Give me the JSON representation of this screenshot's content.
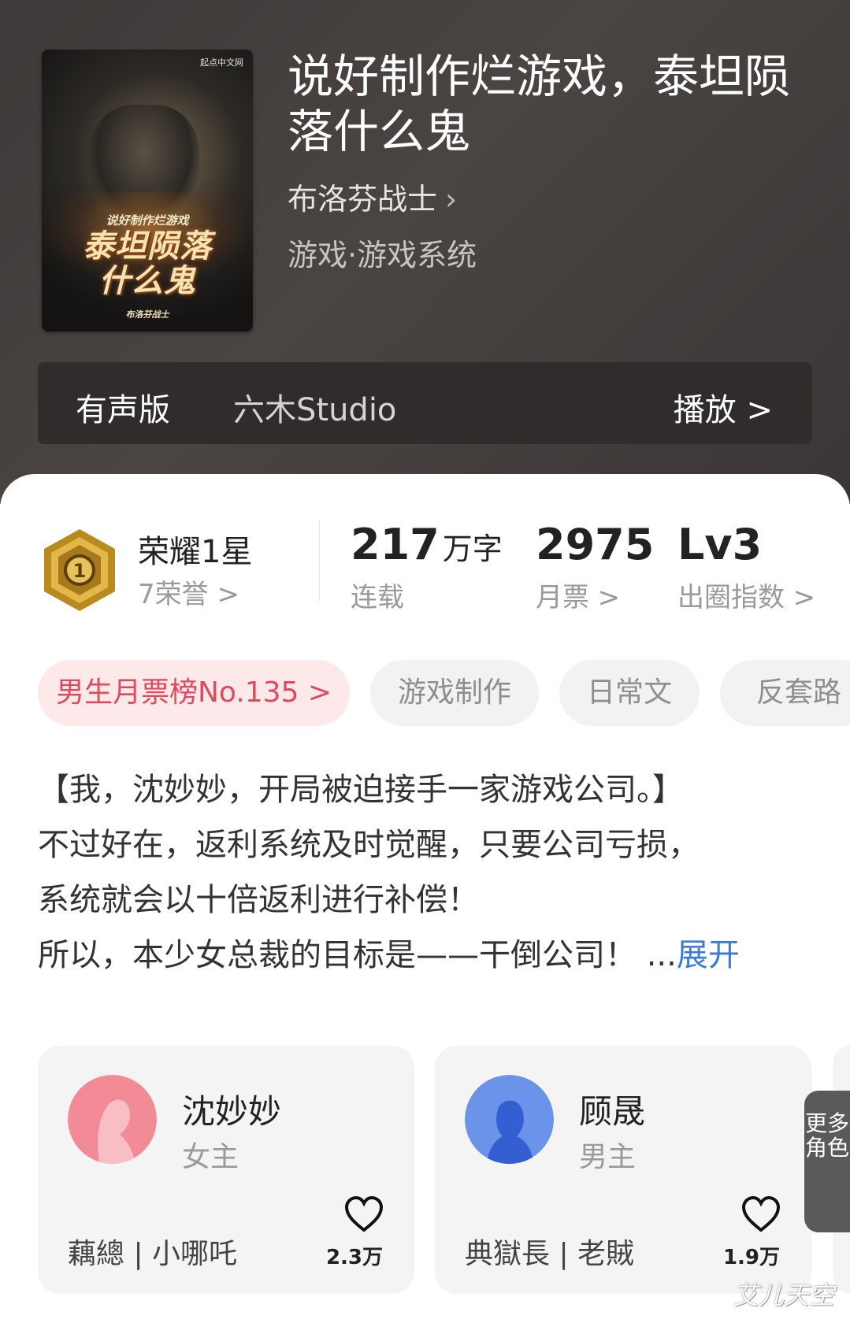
{
  "book": {
    "cover": {
      "brand": "起点中文网",
      "small_title": "说好制作烂游戏",
      "big_title_line1": "泰坦陨落",
      "big_title_line2": "什么鬼",
      "cover_author": "布洛芬战士"
    },
    "title": "说好制作烂游戏，泰坦陨落什么鬼",
    "author": "布洛芬战士",
    "genre": "游戏·游戏系统"
  },
  "audio": {
    "label": "有声版",
    "studio": "六木Studio",
    "play_label": "播放 >"
  },
  "honor": {
    "title": "荣耀1星",
    "sub": "7荣誉 >",
    "badge_number": "1"
  },
  "stats": {
    "words_value": "217",
    "words_unit": "万字",
    "words_label": "连载",
    "tickets_value": "2975",
    "tickets_label": "月票 >",
    "level_value": "Lv3",
    "level_label": "出圈指数 >"
  },
  "tags": [
    "男生月票榜No.135 >",
    "游戏制作",
    "日常文",
    "反套路"
  ],
  "description": {
    "line1": "【我，沈妙妙，开局被迫接手一家游戏公司。】",
    "line2": "不过好在，返利系统及时觉醒，只要公司亏损，",
    "line3": "系统就会以十倍返利进行补偿！",
    "line4": "所以，本少女总裁的目标是——干倒公司！ ...",
    "expand": "展开"
  },
  "roles": [
    {
      "name": "沈妙妙",
      "type": "女主",
      "cv": "藕總 | 小哪吒",
      "likes": "2.3万",
      "color": "#f06a78"
    },
    {
      "name": "顾晟",
      "type": "男主",
      "cv": "典獄長 | 老賊",
      "likes": "1.9万",
      "color": "#5b86e6"
    }
  ],
  "more_roles": "更多角色",
  "watermark": "艾儿天空"
}
